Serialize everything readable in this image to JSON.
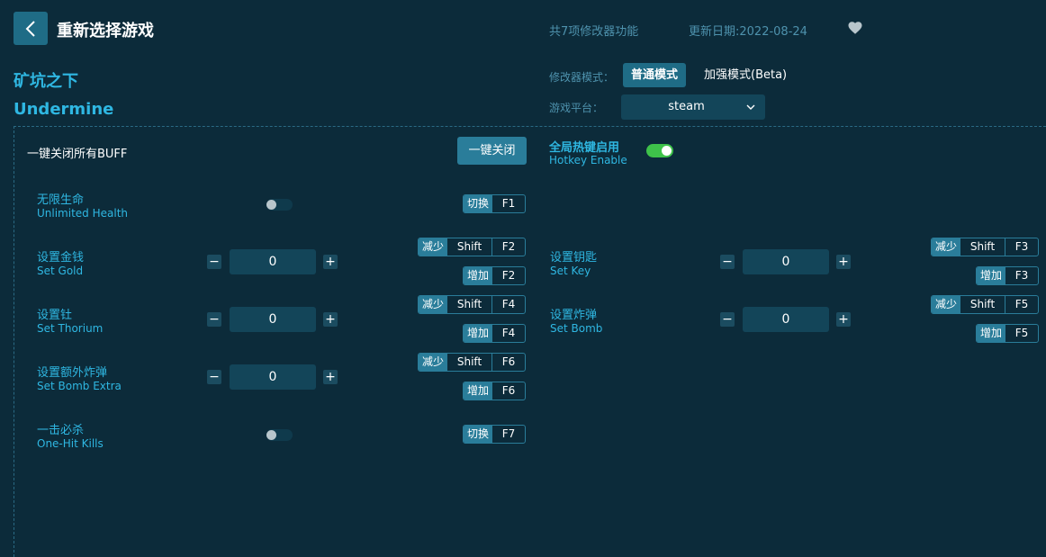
{
  "header": {
    "back_icon": "chevron-left-icon",
    "title": "重新选择游戏",
    "feature_count": "共7项修改器功能",
    "update_date": "更新日期:2022-08-24",
    "favorite_icon": "heart-icon"
  },
  "game": {
    "name_cn": "矿坑之下",
    "name_en": "Undermine"
  },
  "mode": {
    "label": "修改器模式：",
    "normal": "普通模式",
    "enhanced": "加强模式(Beta)"
  },
  "platform": {
    "label": "游戏平台：",
    "value": "steam"
  },
  "buff": {
    "label": "一键关闭所有BUFF",
    "button": "一键关闭"
  },
  "hotkey": {
    "label_cn": "全局热键启用",
    "label_en": "Hotkey Enable",
    "enabled": true
  },
  "options": [
    {
      "cn": "无限生命",
      "en": "Unlimited Health",
      "type": "toggle",
      "hk_action": "切换",
      "hk_key": "F1"
    },
    {
      "cn": "设置金钱",
      "en": "Set Gold",
      "type": "stepper",
      "value": "0",
      "dec_action": "减少",
      "dec_mod": "Shift",
      "dec_key": "F2",
      "inc_action": "增加",
      "inc_key": "F2"
    },
    {
      "cn": "设置钥匙",
      "en": "Set Key",
      "type": "stepper",
      "value": "0",
      "dec_action": "减少",
      "dec_mod": "Shift",
      "dec_key": "F3",
      "inc_action": "增加",
      "inc_key": "F3"
    },
    {
      "cn": "设置钍",
      "en": "Set Thorium",
      "type": "stepper",
      "value": "0",
      "dec_action": "减少",
      "dec_mod": "Shift",
      "dec_key": "F4",
      "inc_action": "增加",
      "inc_key": "F4"
    },
    {
      "cn": "设置炸弹",
      "en": "Set Bomb",
      "type": "stepper",
      "value": "0",
      "dec_action": "减少",
      "dec_mod": "Shift",
      "dec_key": "F5",
      "inc_action": "增加",
      "inc_key": "F5"
    },
    {
      "cn": "设置额外炸弹",
      "en": "Set Bomb Extra",
      "type": "stepper",
      "value": "0",
      "dec_action": "减少",
      "dec_mod": "Shift",
      "dec_key": "F6",
      "inc_action": "增加",
      "inc_key": "F6"
    },
    {
      "cn": "一击必杀",
      "en": "One-Hit Kills",
      "type": "toggle",
      "hk_action": "切换",
      "hk_key": "F7"
    }
  ],
  "stepper": {
    "minus": "−",
    "plus": "+"
  },
  "colors": {
    "background": "#0c2b3a",
    "accent": "#2fb7e2",
    "button": "#1f6c86",
    "toggle_on": "#3ec24a",
    "muted_text": "#4e92ad"
  }
}
